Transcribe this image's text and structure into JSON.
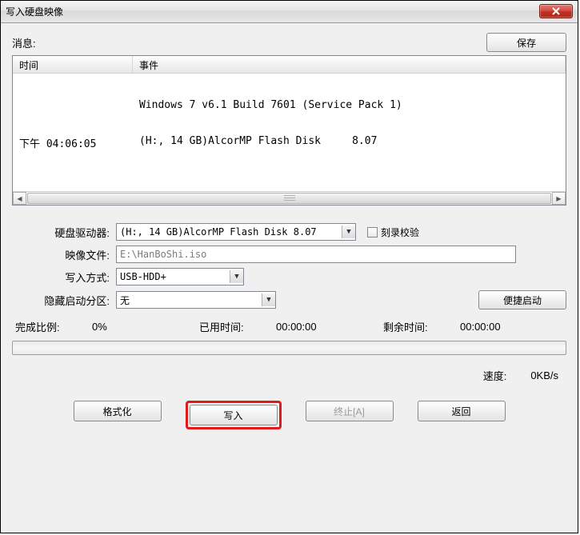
{
  "window": {
    "title": "写入硬盘映像"
  },
  "buttons": {
    "save": "保存",
    "format": "格式化",
    "write": "写入",
    "abort": "终止[A]",
    "return": "返回",
    "convenient_boot": "便捷启动"
  },
  "labels": {
    "message": "消息:",
    "col_time": "时间",
    "col_event": "事件",
    "drive": "硬盘驱动器:",
    "image_file": "映像文件:",
    "write_method": "写入方式:",
    "hide_boot_partition": "隐藏启动分区:",
    "verify": "刻录校验",
    "progress": "完成比例:",
    "elapsed": "已用时间:",
    "remaining": "剩余时间:",
    "speed": "速度:"
  },
  "log": {
    "rows": [
      {
        "time": "",
        "event": "Windows 7 v6.1 Build 7601 (Service Pack 1)"
      },
      {
        "time": "下午 04:06:05",
        "event": "(H:, 14 GB)AlcorMP Flash Disk     8.07"
      }
    ]
  },
  "form": {
    "drive_selected": "(H:, 14 GB)AlcorMP Flash Disk     8.07",
    "image_file_value": "E:\\HanBoShi.iso",
    "write_method_selected": "USB-HDD+",
    "hide_partition_selected": "无",
    "verify_checked": false
  },
  "status": {
    "progress_value": "0%",
    "elapsed_value": "00:00:00",
    "remaining_value": "00:00:00",
    "speed_value": "0KB/s"
  },
  "icons": {
    "close": "close-icon",
    "dropdown": "chevron-down-icon",
    "scroll_left": "triangle-left-icon",
    "scroll_right": "triangle-right-icon"
  }
}
